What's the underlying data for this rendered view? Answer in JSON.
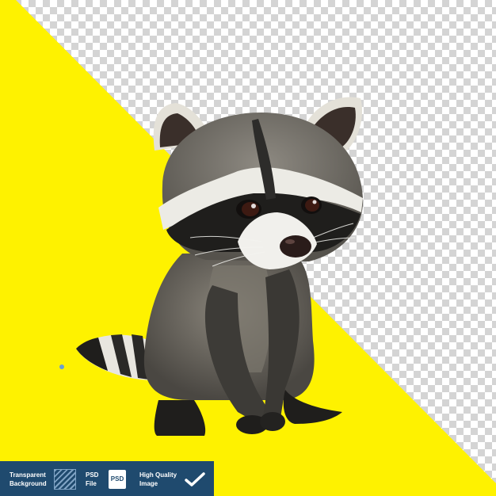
{
  "scene": {
    "subject": "raccoon-3d-illustration",
    "colors": {
      "background_yellow": "#fef200",
      "checker_light": "#ffffff",
      "checker_dark": "#d4d4d4",
      "fur_grey": "#66635d",
      "fur_dark": "#2d2c2a",
      "fur_light": "#e8e6df",
      "badge_blue": "#1f4a6e"
    }
  },
  "badges": {
    "transparent_line1": "Transparent",
    "transparent_line2": "Background",
    "psd_line1": "PSD",
    "psd_line2": "File",
    "psd_icon_label": "PSD",
    "quality_line1": "High Quality",
    "quality_line2": "Image",
    "icons": [
      "diagonal-hatch-icon",
      "psd-file-icon",
      "checkmark-icon"
    ]
  }
}
